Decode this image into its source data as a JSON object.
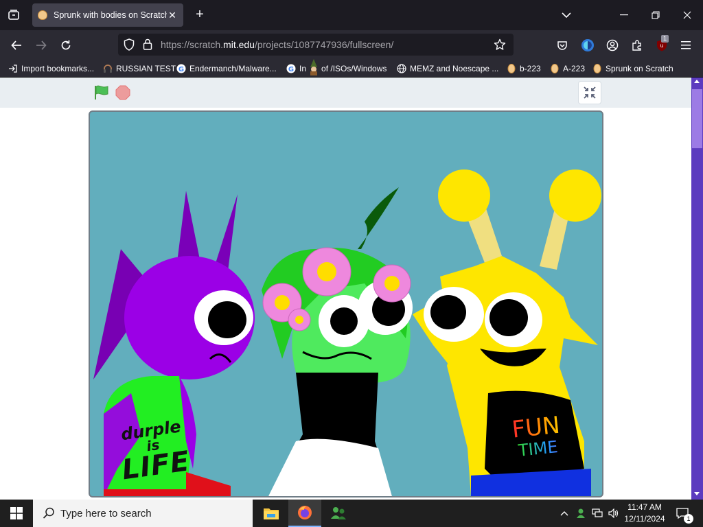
{
  "browser": {
    "tab": {
      "title": "Sprunk with bodies on Scratch"
    },
    "url": {
      "prefix": "https://scratch.",
      "domain": "mit.edu",
      "path": "/projects/1087747936/fullscreen/"
    },
    "extension_badge": "1",
    "bookmarks": [
      {
        "label": "Import bookmarks...",
        "icon": "import-icon"
      },
      {
        "label": "RUSSIAN TEST",
        "icon": "headset-icon"
      },
      {
        "label": "Endermanch/Malware...",
        "icon": "google-icon"
      },
      {
        "label": "In",
        "icon": "google-icon"
      },
      {
        "label": "of /ISOs/Windows",
        "icon": "bookmark-icon"
      },
      {
        "label": "MEMZ and Noescape ...",
        "icon": "globe-icon"
      },
      {
        "label": "b-223",
        "icon": "scratch-icon"
      },
      {
        "label": "A-223",
        "icon": "scratch-icon"
      },
      {
        "label": "Sprunk on Scratch",
        "icon": "scratch-icon"
      }
    ]
  },
  "stage": {
    "shirt_left": {
      "line1": "durple",
      "line2": "is",
      "line3": "LIFE"
    },
    "shirt_right": {
      "line1": "FUN",
      "line2": "TIME"
    }
  },
  "taskbar": {
    "search_placeholder": "Type here to search",
    "time": "11:47 AM",
    "date": "12/11/2024",
    "notification_count": "1"
  },
  "colors": {
    "stage_bg": "#62aebd",
    "purple_character": "#9b00e6",
    "yellow_character": "#fee600",
    "green_character": "#4fea5e"
  }
}
